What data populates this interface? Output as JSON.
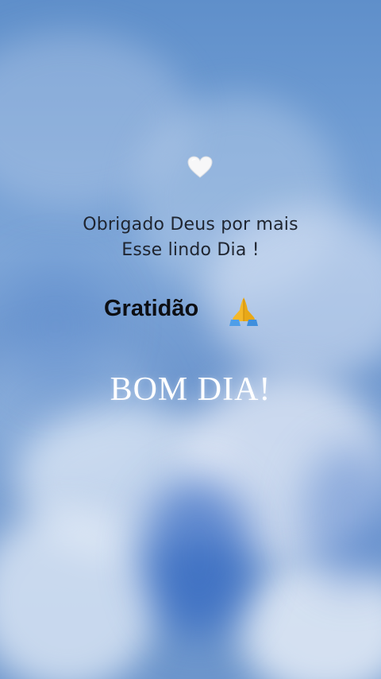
{
  "message": {
    "line1": "Obrigado Deus por mais",
    "line2": "Esse lindo Dia !",
    "gratitude_label": "Gratidão",
    "greeting": "BOM DIA!"
  },
  "icons": {
    "top": "white-heart-icon",
    "gratitude": "praying-hands-icon"
  },
  "colors": {
    "sky_blue": "#6f98cf",
    "text_dark": "#1f2530",
    "greeting_white": "#ffffff"
  }
}
